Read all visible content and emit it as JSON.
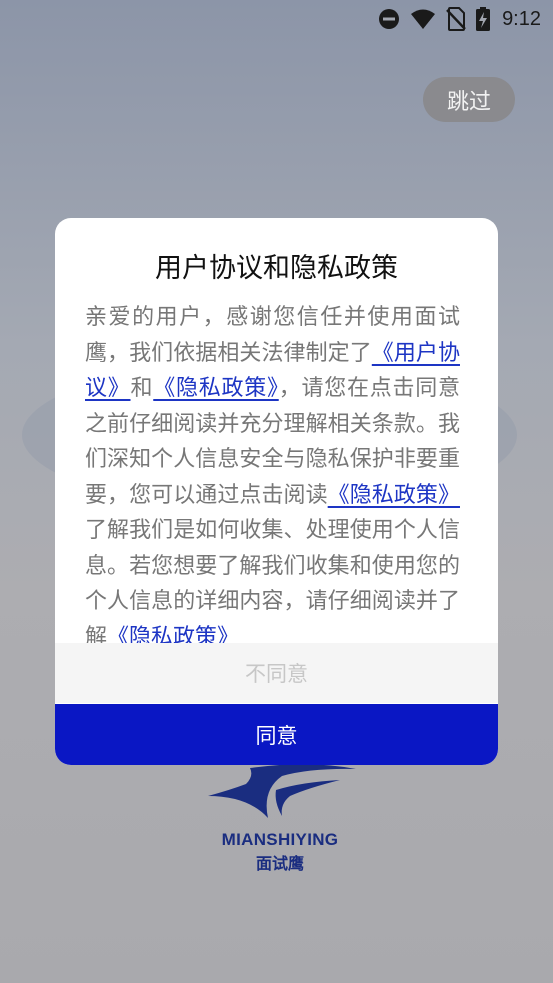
{
  "status_bar": {
    "time": "9:12",
    "icons": [
      "do-not-disturb-icon",
      "wifi-icon",
      "no-sim-icon",
      "battery-charging-icon"
    ]
  },
  "skip_label": "跳过",
  "dialog": {
    "title": "用户协议和隐私政策",
    "body": {
      "p1": "亲爱的用户，感谢您信任并使用面试鹰，我们依据相关法律制定了",
      "link_user_agreement": "《用户协议》",
      "and": "和",
      "link_privacy_1": "《隐私政策》",
      "p2": "，请您在点击同意之前仔细阅读并充分理解相关条款。我们深知个人信息安全与隐私保护非要重要，您可以通过点击阅读",
      "link_privacy_2": "《隐私政策》",
      "p3": "了解我们是如何收集、处理使用个人信息。若您想要了解我们收集和使用您的个人信息的详细内容，请仔细阅读并了解",
      "link_privacy_3": "《隐私政策》"
    },
    "disagree_label": "不同意",
    "agree_label": "同意"
  },
  "logo": {
    "wordmark": "MIANSHIYING",
    "cn_name": "面试鹰",
    "color": "#1a2d80"
  },
  "colors": {
    "link": "#1d35c4",
    "agree_bg": "#0a17c4"
  }
}
